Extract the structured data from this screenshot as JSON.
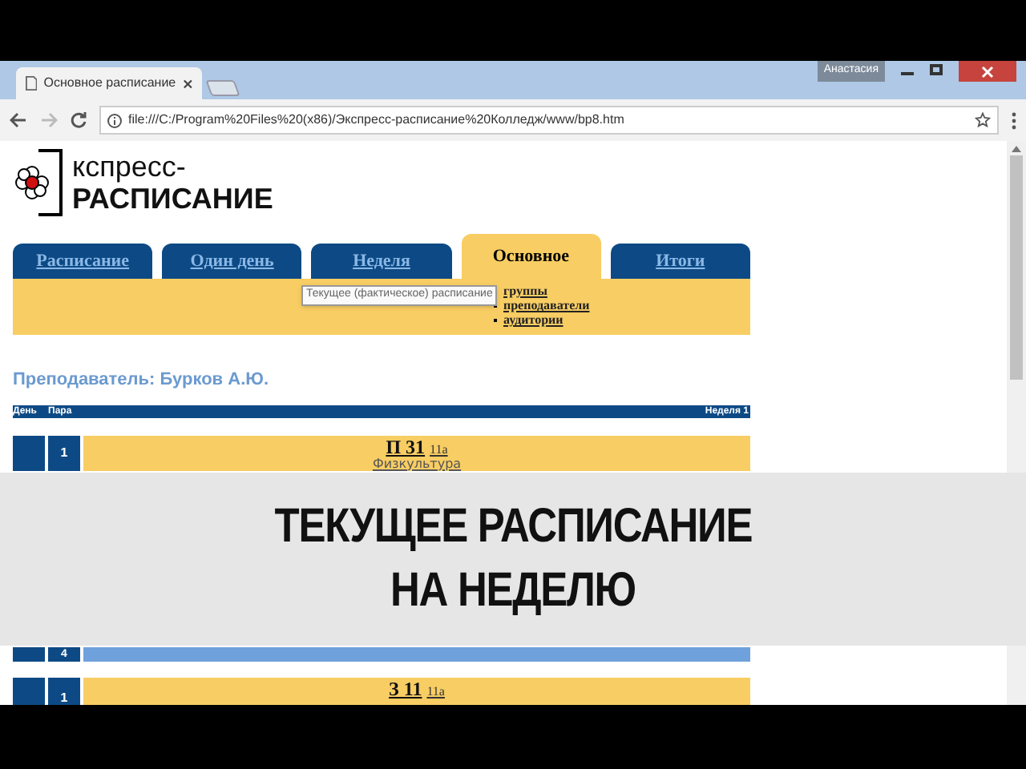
{
  "browser": {
    "tab_title": "Основное расписание",
    "user": "Анастасия",
    "url": "file:///C:/Program%20Files%20(x86)/Экспресс-расписание%20Колледж/www/bp8.htm"
  },
  "logo": {
    "line1": "кспресс-",
    "line2": "РАСПИСАНИЕ"
  },
  "tabs": [
    {
      "label": "Расписание",
      "selected": false
    },
    {
      "label": "Один день",
      "selected": false
    },
    {
      "label": "Неделя",
      "selected": false
    },
    {
      "label": "Основное",
      "selected": true
    },
    {
      "label": "Итоги",
      "selected": false
    }
  ],
  "submenu": [
    "группы",
    "преподаватели",
    "аудитории"
  ],
  "tooltip": "Текущее (фактическое) расписание",
  "heading": "Преподаватель: Бурков А.Ю.",
  "table": {
    "columns": [
      "День",
      "Пара",
      "Неделя 1"
    ],
    "rows": [
      {
        "kind": "lesson",
        "para": "1",
        "group": "П 31",
        "room": "11а",
        "subject": "Физкультура"
      },
      {
        "kind": "empty",
        "para": "4"
      },
      {
        "kind": "lesson",
        "para": "1",
        "group": "З 11",
        "room": "11а"
      }
    ]
  },
  "caption": [
    "ТЕКУЩЕЕ РАСПИСАНИЕ",
    "НА НЕДЕЛЮ"
  ]
}
